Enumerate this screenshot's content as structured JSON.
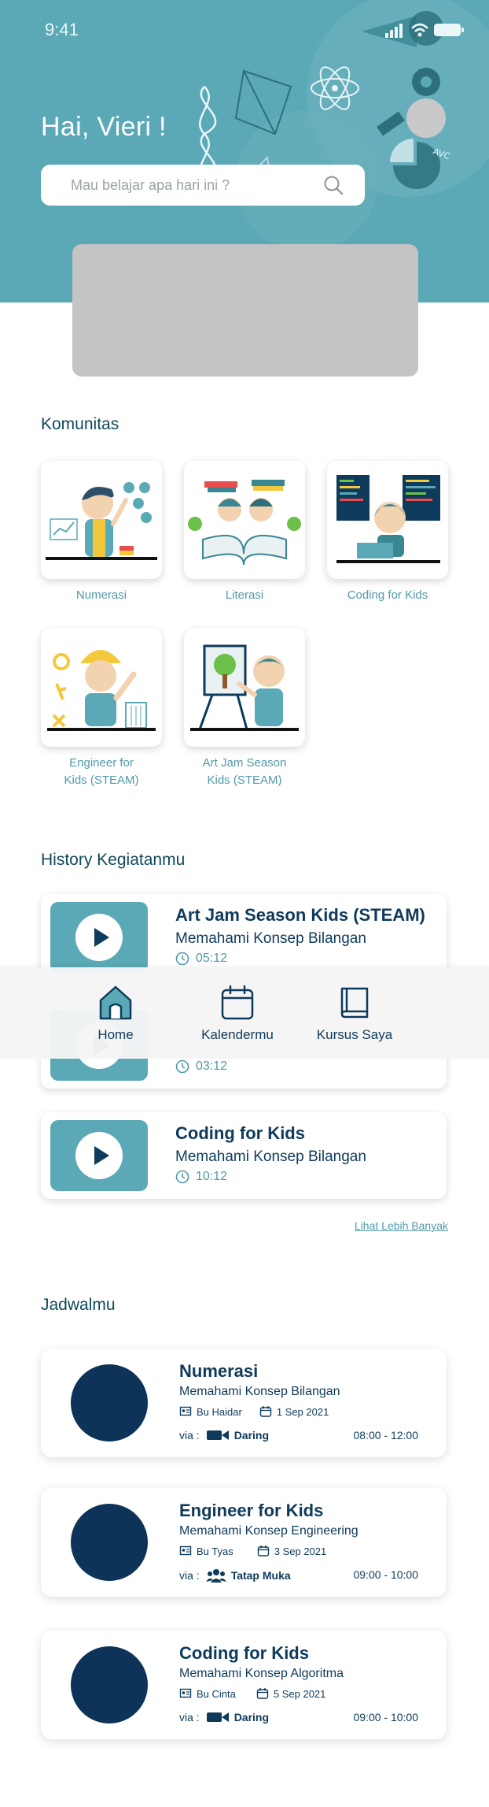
{
  "status_bar": {
    "time": "9:41"
  },
  "header": {
    "greeting": "Hai, Vieri !",
    "search_placeholder": "Mau belajar apa hari ini ?",
    "bg_color": "#5ba9b6",
    "banner_color": "#c4c4c4"
  },
  "komunitas": {
    "title": "Komunitas",
    "items": [
      {
        "label": "Numerasi",
        "icon": "numeracy-illustration"
      },
      {
        "label": "Literasi",
        "icon": "literacy-illustration"
      },
      {
        "label": "Coding for Kids",
        "icon": "coding-illustration"
      },
      {
        "label": "Engineer for Kids (STEAM)",
        "line1": "Engineer for",
        "line2": "Kids (STEAM)",
        "icon": "engineer-illustration"
      },
      {
        "label": "Art Jam Season Kids (STEAM)",
        "line1": "Art Jam Season",
        "line2": "Kids (STEAM)",
        "icon": "art-illustration"
      }
    ]
  },
  "history": {
    "title": "History Kegiatanmu",
    "items": [
      {
        "title": "Art Jam Season Kids (STEAM)",
        "subtitle": "Memahami Konsep Bilangan",
        "duration": "05:12"
      },
      {
        "title": "",
        "subtitle": "",
        "duration": "03:12"
      },
      {
        "title": "Coding for Kids",
        "subtitle": "Memahami Konsep Bilangan",
        "duration": "10:12"
      }
    ],
    "see_more": "Lihat Lebih Banyak"
  },
  "bottom_nav": {
    "items": [
      {
        "label": "Home",
        "icon": "home-icon",
        "active": true
      },
      {
        "label": "Kalendermu",
        "icon": "calendar-icon",
        "active": false
      },
      {
        "label": "Kursus Saya",
        "icon": "book-icon",
        "active": false
      }
    ]
  },
  "jadwal": {
    "title": "Jadwalmu",
    "via_label": "via :",
    "items": [
      {
        "title": "Numerasi",
        "subtitle": "Memahami Konsep Bilangan",
        "teacher": "Bu Haidar",
        "date": "1 Sep 2021",
        "mode": "Daring",
        "mode_icon": "video-camera-icon",
        "hours": "08:00 - 12:00"
      },
      {
        "title": "Engineer for Kids",
        "subtitle": "Memahami Konsep Engineering",
        "teacher": "Bu Tyas",
        "date": "3 Sep 2021",
        "mode": "Tatap Muka",
        "mode_icon": "group-icon",
        "hours": "09:00 - 10:00"
      },
      {
        "title": "Coding for Kids",
        "subtitle": "Memahami Konsep Algoritma",
        "teacher": "Bu Cinta",
        "date": "5 Sep 2021",
        "mode": "Daring",
        "mode_icon": "video-camera-icon",
        "hours": "09:00 - 10:00"
      }
    ]
  },
  "colors": {
    "primary": "#5ba9b6",
    "dark": "#0e3a5b",
    "accent_text": "#4f9aab"
  }
}
